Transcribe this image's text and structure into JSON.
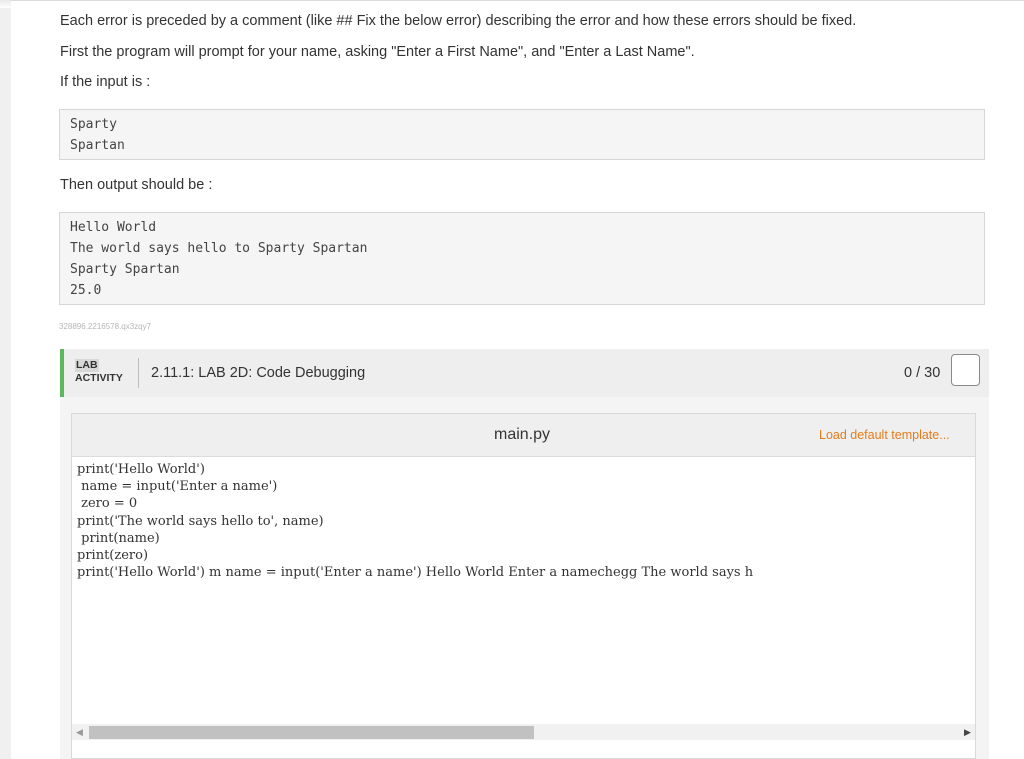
{
  "instructions": {
    "line1": "Each error is preceded by a comment (like ## Fix the below error) describing the error and how these errors should be fixed.",
    "line2": "First the program will prompt for your name, asking \"Enter a First Name\", and \"Enter a Last Name\".",
    "line3": "If the input is :",
    "line4": "Then output should be :"
  },
  "sample_input": [
    "Sparty",
    "Spartan"
  ],
  "sample_output": [
    "Hello World",
    "The world says hello to Sparty Spartan",
    "Sparty Spartan",
    "25.0"
  ],
  "content_id": "328896.2216578.qx3zqy7",
  "lab": {
    "tag_line1": "LAB",
    "tag_line2": "ACTIVITY",
    "title": "2.11.1: LAB 2D: Code Debugging",
    "score": "0 / 30"
  },
  "editor": {
    "filename": "main.py",
    "load_template": "Load default template...",
    "code_lines": [
      "print('Hello World')",
      " name = input('Enter a name')",
      " zero = 0",
      "print('The world says hello to', name)",
      " print(name)",
      "print(zero)",
      "print('Hello World') m name = input('Enter a name') Hello World Enter a namechegg The world says h"
    ]
  },
  "colors": {
    "accent_green": "#5cb85c",
    "link_orange": "#e57c1b"
  }
}
